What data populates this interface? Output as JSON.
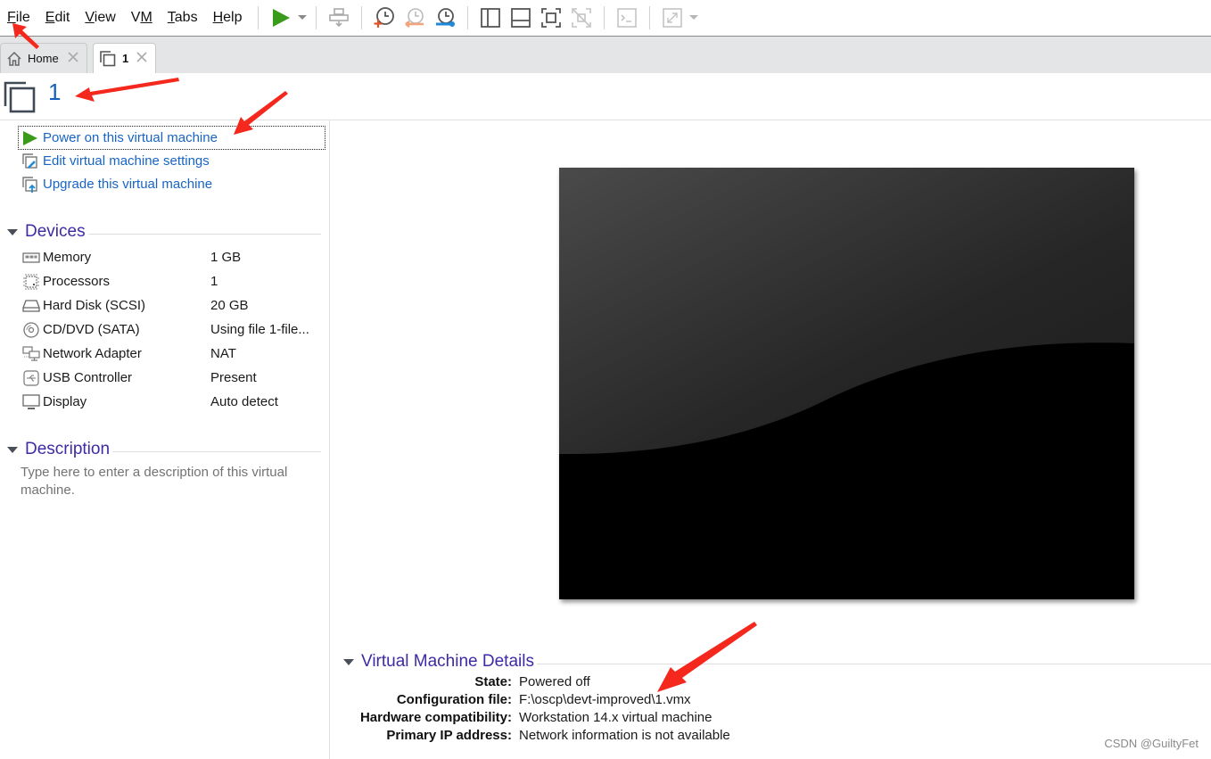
{
  "menu": {
    "items": [
      {
        "label": "File",
        "accel": "F"
      },
      {
        "label": "Edit",
        "accel": "E"
      },
      {
        "label": "View",
        "accel": "V"
      },
      {
        "label": "VM",
        "accel": "M"
      },
      {
        "label": "Tabs",
        "accel": "T"
      },
      {
        "label": "Help",
        "accel": "H"
      }
    ]
  },
  "toolbar": {
    "icons": [
      "power-on-icon",
      "send-ctrl-alt-del-icon",
      "take-snapshot-icon",
      "revert-snapshot-icon",
      "manage-snapshots-icon",
      "show-library-icon",
      "show-thumbnail-bar-icon",
      "full-screen-icon",
      "unity-icon",
      "console-view-icon",
      "stretch-guest-icon"
    ]
  },
  "tabs": [
    {
      "label": "Home",
      "icon": "home-icon",
      "active": false
    },
    {
      "label": "1",
      "icon": "vm-icon",
      "active": true
    }
  ],
  "header": {
    "title": "1"
  },
  "actions": [
    {
      "label": "Power on this virtual machine",
      "icon": "power-on-icon"
    },
    {
      "label": "Edit virtual machine settings",
      "icon": "edit-settings-icon"
    },
    {
      "label": "Upgrade this virtual machine",
      "icon": "upgrade-icon"
    }
  ],
  "devices": {
    "title": "Devices",
    "items": [
      {
        "name": "Memory",
        "value": "1 GB",
        "icon": "memory-icon"
      },
      {
        "name": "Processors",
        "value": "1",
        "icon": "processor-icon"
      },
      {
        "name": "Hard Disk (SCSI)",
        "value": "20 GB",
        "icon": "hard-disk-icon"
      },
      {
        "name": "CD/DVD (SATA)",
        "value": "Using file 1-file...",
        "icon": "cd-dvd-icon"
      },
      {
        "name": "Network Adapter",
        "value": "NAT",
        "icon": "network-adapter-icon"
      },
      {
        "name": "USB Controller",
        "value": "Present",
        "icon": "usb-icon"
      },
      {
        "name": "Display",
        "value": "Auto detect",
        "icon": "display-icon"
      }
    ]
  },
  "description": {
    "title": "Description",
    "placeholder": "Type here to enter a description of this virtual machine."
  },
  "details": {
    "title": "Virtual Machine Details",
    "rows": [
      {
        "key": "State:",
        "value": "Powered off"
      },
      {
        "key": "Configuration file:",
        "value": "F:\\oscp\\devt-improved\\1.vmx"
      },
      {
        "key": "Hardware compatibility:",
        "value": "Workstation 14.x virtual machine"
      },
      {
        "key": "Primary IP address:",
        "value": "Network information is not available"
      }
    ]
  },
  "watermark": "CSDN @GuiltyFet",
  "colors": {
    "link": "#1864c6",
    "section": "#3e2aa5",
    "title": "#1560bd",
    "power_green": "#3a9a1a",
    "annotation_red": "#f4281c"
  }
}
